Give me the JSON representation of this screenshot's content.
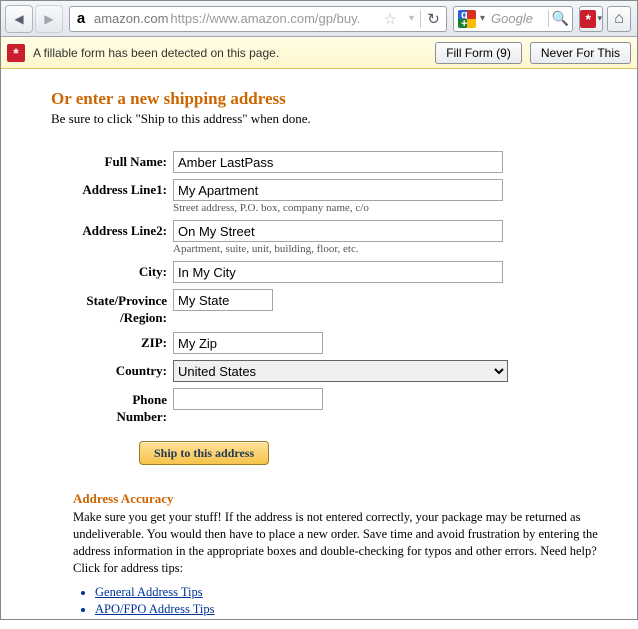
{
  "browser": {
    "url_host": "amazon.com",
    "url_rest": "https://www.amazon.com/gp/buy.",
    "search_placeholder": "Google"
  },
  "infobar": {
    "message": "A fillable form has been detected on this page.",
    "fill_button": "Fill Form (9)",
    "never_button": "Never For This "
  },
  "page": {
    "heading": "Or enter a new shipping address",
    "subtext": "Be sure to click \"Ship to this address\" when done."
  },
  "form": {
    "full_name": {
      "label": "Full Name:",
      "value": "Amber LastPass"
    },
    "address1": {
      "label": "Address Line1:",
      "value": "My Apartment",
      "hint": "Street address, P.O. box, company name, c/o"
    },
    "address2": {
      "label": "Address Line2:",
      "value": "On My Street",
      "hint": "Apartment, suite, unit, building, floor, etc."
    },
    "city": {
      "label": "City:",
      "value": "In My City"
    },
    "state": {
      "label": "State/Province/Region:",
      "value": "My State"
    },
    "zip": {
      "label": "ZIP:",
      "value": "My Zip"
    },
    "country": {
      "label": "Country:",
      "value": "United States"
    },
    "phone": {
      "label": "Phone Number:",
      "value": ""
    },
    "submit_label": "Ship to this address"
  },
  "accuracy": {
    "heading": "Address Accuracy",
    "body": "Make sure you get your stuff! If the address is not entered correctly, your package may be returned as undeliverable. You would then have to place a new order. Save time and avoid frustration by entering the address information in the appropriate boxes and double-checking for typos and other errors. Need help? Click for address tips:",
    "tips": [
      "General Address Tips",
      "APO/FPO Address Tips"
    ]
  }
}
